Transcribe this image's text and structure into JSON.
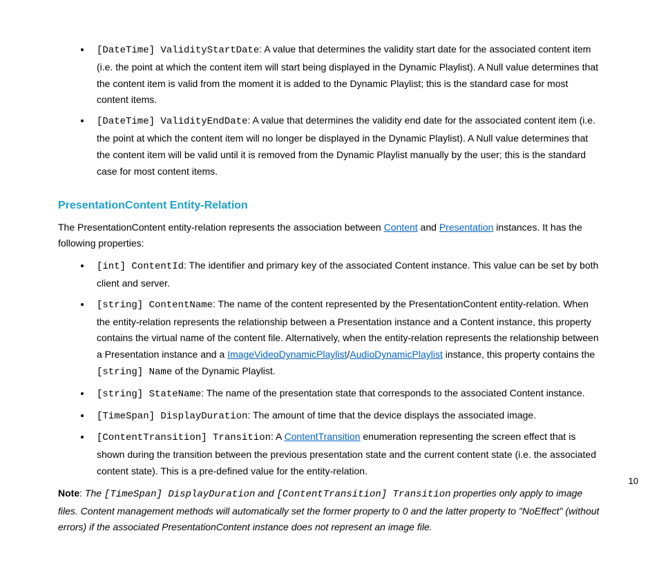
{
  "list1": {
    "items": [
      {
        "code": "[DateTime] ValidityStartDate",
        "text": ": A value that determines the validity start date for the associated content item (i.e. the point at which the content item will start being displayed in the Dynamic Playlist). A Null value determines that the content item is valid from the moment it is added to the Dynamic Playlist; this is the standard case for most content items."
      },
      {
        "code": "[DateTime] ValidityEndDate",
        "text": ": A value that determines the validity end date for the associated content item (i.e. the point at which the content item will no longer be displayed in the Dynamic Playlist). A Null value determines that the content item will be valid until it is removed from the Dynamic Playlist manually by the user; this is the standard case for most content items."
      }
    ]
  },
  "heading2": "PresentationContent Entity-Relation",
  "intro": {
    "pre": "The PresentationContent entity-relation represents the association between ",
    "link1": "Content",
    "mid": " and ",
    "link2": "Presentation",
    "post": " instances. It has the following properties:"
  },
  "list2": {
    "item0": {
      "code": "[int] ContentId",
      "text": ": The identifier and primary key of the associated Content instance. This value can be set by both client and server."
    },
    "item1": {
      "code": "[string] ContentName",
      "text1": ": The name of the content represented by the PresentationContent entity-relation. When the entity-relation represents the relationship between a Presentation instance and a Content instance, this property contains the virtual name of the content file. Alternatively, when the entity-relation represents the relationship between a Presentation instance and a ",
      "link1": "ImageVideoDynamicPlaylist",
      "slash": "/",
      "link2": "AudioDynamicPlaylist",
      "text2": " instance, this property contains the ",
      "code2": "[string] Name",
      "text3": " of the Dynamic Playlist."
    },
    "item2": {
      "code": "[string] StateName",
      "text": ": The name of the presentation state that corresponds to the associated Content instance."
    },
    "item3": {
      "code": "[TimeSpan] DisplayDuration",
      "text": ": The amount of time that the device displays the associated image."
    },
    "item4": {
      "code": "[ContentTransition] Transition",
      "text1": ": A ",
      "link1": "ContentTransition",
      "text2": " enumeration representing the screen effect that is shown during the transition between the previous presentation state and the current content state (i.e. the associated content state). This is a pre-defined value for the entity-relation."
    }
  },
  "note": {
    "label": "Note",
    "pre": ": ",
    "t1": "The ",
    "code1": "[TimeSpan] DisplayDuration",
    "t2": " and ",
    "code2": "[ContentTransition] Transition",
    "t3": " properties only apply to image files. Content management methods will automatically set the former property to 0 and the latter property to \"NoEffect\" (without errors) if the associated PresentationContent instance does not represent an image file."
  },
  "pagenum": "10"
}
